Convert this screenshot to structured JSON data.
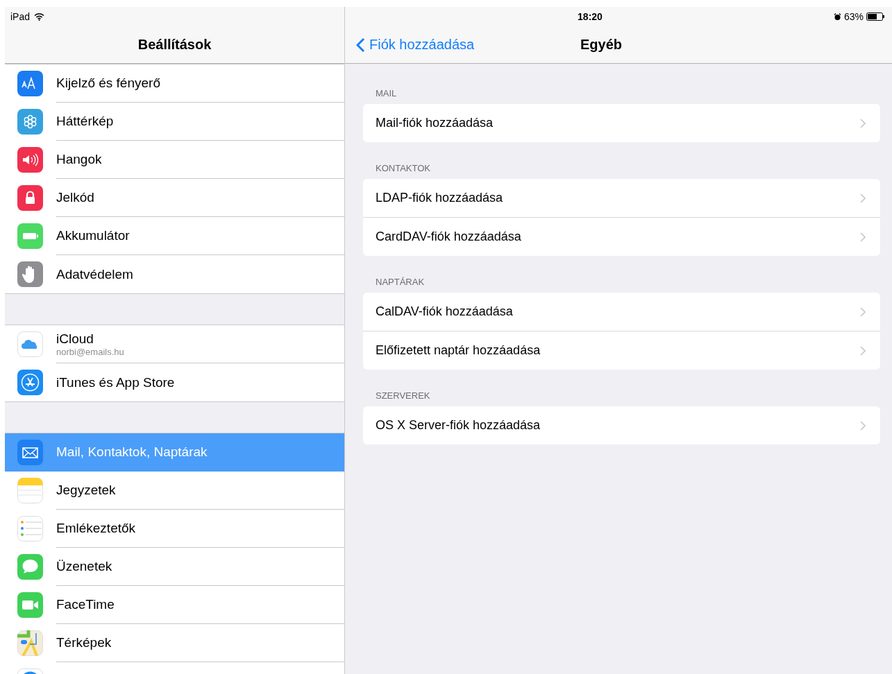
{
  "status_bar": {
    "device": "iPad",
    "time": "18:20",
    "battery": "63%"
  },
  "sidebar": {
    "title": "Beállítások",
    "groups": [
      {
        "items": [
          {
            "label": "Kijelző és fényerő",
            "selected": false
          },
          {
            "label": "Háttérkép",
            "selected": false
          },
          {
            "label": "Hangok",
            "selected": false
          },
          {
            "label": "Jelkód",
            "selected": false
          },
          {
            "label": "Akkumulátor",
            "selected": false
          },
          {
            "label": "Adatvédelem",
            "selected": false
          }
        ]
      },
      {
        "items": [
          {
            "label": "iCloud",
            "subtitle": "norbi@emails.hu",
            "selected": false
          },
          {
            "label": "iTunes és App Store",
            "selected": false
          }
        ]
      },
      {
        "items": [
          {
            "label": "Mail, Kontaktok, Naptárak",
            "selected": true
          },
          {
            "label": "Jegyzetek",
            "selected": false
          },
          {
            "label": "Emlékeztetők",
            "selected": false
          },
          {
            "label": "Üzenetek",
            "selected": false
          },
          {
            "label": "FaceTime",
            "selected": false
          },
          {
            "label": "Térképek",
            "selected": false
          },
          {
            "selected": false
          }
        ]
      }
    ]
  },
  "detail": {
    "back_label": "Fiók hozzáadása",
    "title": "Egyéb",
    "sections": [
      {
        "header": "MAIL",
        "rows": [
          {
            "label": "Mail-fiók hozzáadása"
          }
        ]
      },
      {
        "header": "KONTAKTOK",
        "rows": [
          {
            "label": "LDAP-fiók hozzáadása"
          },
          {
            "label": "CardDAV-fiók hozzáadása"
          }
        ]
      },
      {
        "header": "NAPTÁRAK",
        "rows": [
          {
            "label": "CalDAV-fiók hozzáadása"
          },
          {
            "label": "Előfizetett naptár hozzáadása"
          }
        ]
      },
      {
        "header": "SZERVEREK",
        "rows": [
          {
            "label": "OS X Server-fiók hozzáadása"
          }
        ]
      }
    ]
  }
}
